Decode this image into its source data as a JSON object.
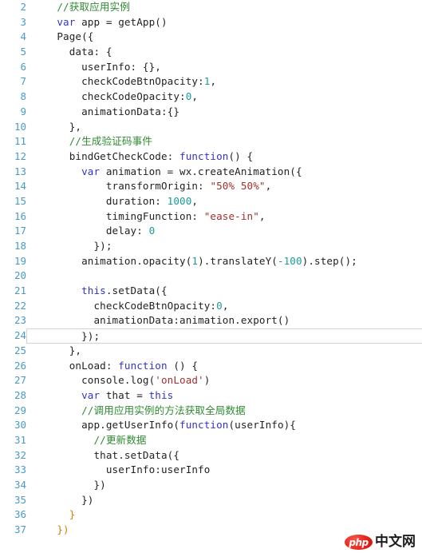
{
  "editor": {
    "first_line_number": 2,
    "current_line_number": 24,
    "colors": {
      "background": "#ffffff",
      "line_number": "#4a9bc4",
      "comment": "#2f8a32",
      "keyword": "#3333cc",
      "number": "#1a9a9a",
      "string": "#a03030",
      "brace": "#d08000",
      "plain_text": "#222222",
      "current_line_border": "#d2d2d2"
    },
    "lines": [
      {
        "n": "2",
        "tokens": [
          {
            "t": "//获取应用实例",
            "c": "cmt"
          }
        ],
        "indent": 2
      },
      {
        "n": "3",
        "tokens": [
          {
            "t": "var",
            "c": "kw"
          },
          {
            "t": " app = getApp()",
            "c": "plain"
          }
        ],
        "indent": 2
      },
      {
        "n": "4",
        "tokens": [
          {
            "t": "Page({",
            "c": "plain"
          }
        ],
        "indent": 2
      },
      {
        "n": "5",
        "tokens": [
          {
            "t": "data: {",
            "c": "plain"
          }
        ],
        "indent": 4
      },
      {
        "n": "6",
        "tokens": [
          {
            "t": "userInfo: {},",
            "c": "plain"
          }
        ],
        "indent": 6
      },
      {
        "n": "7",
        "tokens": [
          {
            "t": "checkCodeBtnOpacity:",
            "c": "plain"
          },
          {
            "t": "1",
            "c": "num"
          },
          {
            "t": ",",
            "c": "plain"
          }
        ],
        "indent": 6
      },
      {
        "n": "8",
        "tokens": [
          {
            "t": "checkCodeOpacity:",
            "c": "plain"
          },
          {
            "t": "0",
            "c": "num"
          },
          {
            "t": ",",
            "c": "plain"
          }
        ],
        "indent": 6
      },
      {
        "n": "9",
        "tokens": [
          {
            "t": "animationData:{}",
            "c": "plain"
          }
        ],
        "indent": 6
      },
      {
        "n": "10",
        "tokens": [
          {
            "t": "},",
            "c": "plain"
          }
        ],
        "indent": 4
      },
      {
        "n": "11",
        "tokens": [
          {
            "t": "//生成验证码事件",
            "c": "cmt"
          }
        ],
        "indent": 4
      },
      {
        "n": "12",
        "tokens": [
          {
            "t": "bindGetCheckCode: ",
            "c": "plain"
          },
          {
            "t": "function",
            "c": "kw"
          },
          {
            "t": "() {",
            "c": "plain"
          }
        ],
        "indent": 4
      },
      {
        "n": "13",
        "tokens": [
          {
            "t": "var",
            "c": "kw"
          },
          {
            "t": " animation = wx.createAnimation({",
            "c": "plain"
          }
        ],
        "indent": 6
      },
      {
        "n": "14",
        "tokens": [
          {
            "t": "transformOrigin: ",
            "c": "plain"
          },
          {
            "t": "\"50% 50%\"",
            "c": "str"
          },
          {
            "t": ",",
            "c": "plain"
          }
        ],
        "indent": 10
      },
      {
        "n": "15",
        "tokens": [
          {
            "t": "duration: ",
            "c": "plain"
          },
          {
            "t": "1000",
            "c": "num"
          },
          {
            "t": ",",
            "c": "plain"
          }
        ],
        "indent": 10
      },
      {
        "n": "16",
        "tokens": [
          {
            "t": "timingFunction: ",
            "c": "plain"
          },
          {
            "t": "\"ease-in\"",
            "c": "str"
          },
          {
            "t": ",",
            "c": "plain"
          }
        ],
        "indent": 10
      },
      {
        "n": "17",
        "tokens": [
          {
            "t": "delay: ",
            "c": "plain"
          },
          {
            "t": "0",
            "c": "num"
          }
        ],
        "indent": 10
      },
      {
        "n": "18",
        "tokens": [
          {
            "t": "});",
            "c": "plain"
          }
        ],
        "indent": 8
      },
      {
        "n": "19",
        "tokens": [
          {
            "t": "animation.opacity(",
            "c": "plain"
          },
          {
            "t": "1",
            "c": "num"
          },
          {
            "t": ").translateY(",
            "c": "plain"
          },
          {
            "t": "-100",
            "c": "num"
          },
          {
            "t": ").step();",
            "c": "plain"
          }
        ],
        "indent": 6
      },
      {
        "n": "20",
        "tokens": [],
        "indent": 0
      },
      {
        "n": "21",
        "tokens": [
          {
            "t": "this",
            "c": "kw"
          },
          {
            "t": ".setData({",
            "c": "plain"
          }
        ],
        "indent": 6
      },
      {
        "n": "22",
        "tokens": [
          {
            "t": "checkCodeBtnOpacity:",
            "c": "plain"
          },
          {
            "t": "0",
            "c": "num"
          },
          {
            "t": ",",
            "c": "plain"
          }
        ],
        "indent": 8
      },
      {
        "n": "23",
        "tokens": [
          {
            "t": "animationData:animation.export()",
            "c": "plain"
          }
        ],
        "indent": 8
      },
      {
        "n": "24",
        "tokens": [
          {
            "t": "});",
            "c": "plain"
          }
        ],
        "indent": 6
      },
      {
        "n": "25",
        "tokens": [
          {
            "t": "},",
            "c": "plain"
          }
        ],
        "indent": 4
      },
      {
        "n": "26",
        "tokens": [
          {
            "t": "onLoad: ",
            "c": "plain"
          },
          {
            "t": "function",
            "c": "kw"
          },
          {
            "t": " () {",
            "c": "plain"
          }
        ],
        "indent": 4
      },
      {
        "n": "27",
        "tokens": [
          {
            "t": "console.log(",
            "c": "plain"
          },
          {
            "t": "'onLoad'",
            "c": "str"
          },
          {
            "t": ")",
            "c": "plain"
          }
        ],
        "indent": 6
      },
      {
        "n": "28",
        "tokens": [
          {
            "t": "var",
            "c": "kw"
          },
          {
            "t": " that = ",
            "c": "plain"
          },
          {
            "t": "this",
            "c": "kw"
          }
        ],
        "indent": 6
      },
      {
        "n": "29",
        "tokens": [
          {
            "t": "//调用应用实例的方法获取全局数据",
            "c": "cmt"
          }
        ],
        "indent": 6
      },
      {
        "n": "30",
        "tokens": [
          {
            "t": "app.getUserInfo(",
            "c": "plain"
          },
          {
            "t": "function",
            "c": "kw"
          },
          {
            "t": "(userInfo){",
            "c": "plain"
          }
        ],
        "indent": 6
      },
      {
        "n": "31",
        "tokens": [
          {
            "t": "//更新数据",
            "c": "cmt"
          }
        ],
        "indent": 8
      },
      {
        "n": "32",
        "tokens": [
          {
            "t": "that.setData({",
            "c": "plain"
          }
        ],
        "indent": 8
      },
      {
        "n": "33",
        "tokens": [
          {
            "t": "userInfo:userInfo",
            "c": "plain"
          }
        ],
        "indent": 10
      },
      {
        "n": "34",
        "tokens": [
          {
            "t": "})",
            "c": "plain"
          }
        ],
        "indent": 8
      },
      {
        "n": "35",
        "tokens": [
          {
            "t": "})",
            "c": "plain"
          }
        ],
        "indent": 6
      },
      {
        "n": "36",
        "tokens": [
          {
            "t": "}",
            "c": "brace"
          }
        ],
        "indent": 4
      },
      {
        "n": "37",
        "tokens": [
          {
            "t": "})",
            "c": "brace"
          }
        ],
        "indent": 2
      }
    ]
  },
  "watermark": {
    "logo_text": "php",
    "site_text": "中文网",
    "logo_color": "#e8251a"
  }
}
